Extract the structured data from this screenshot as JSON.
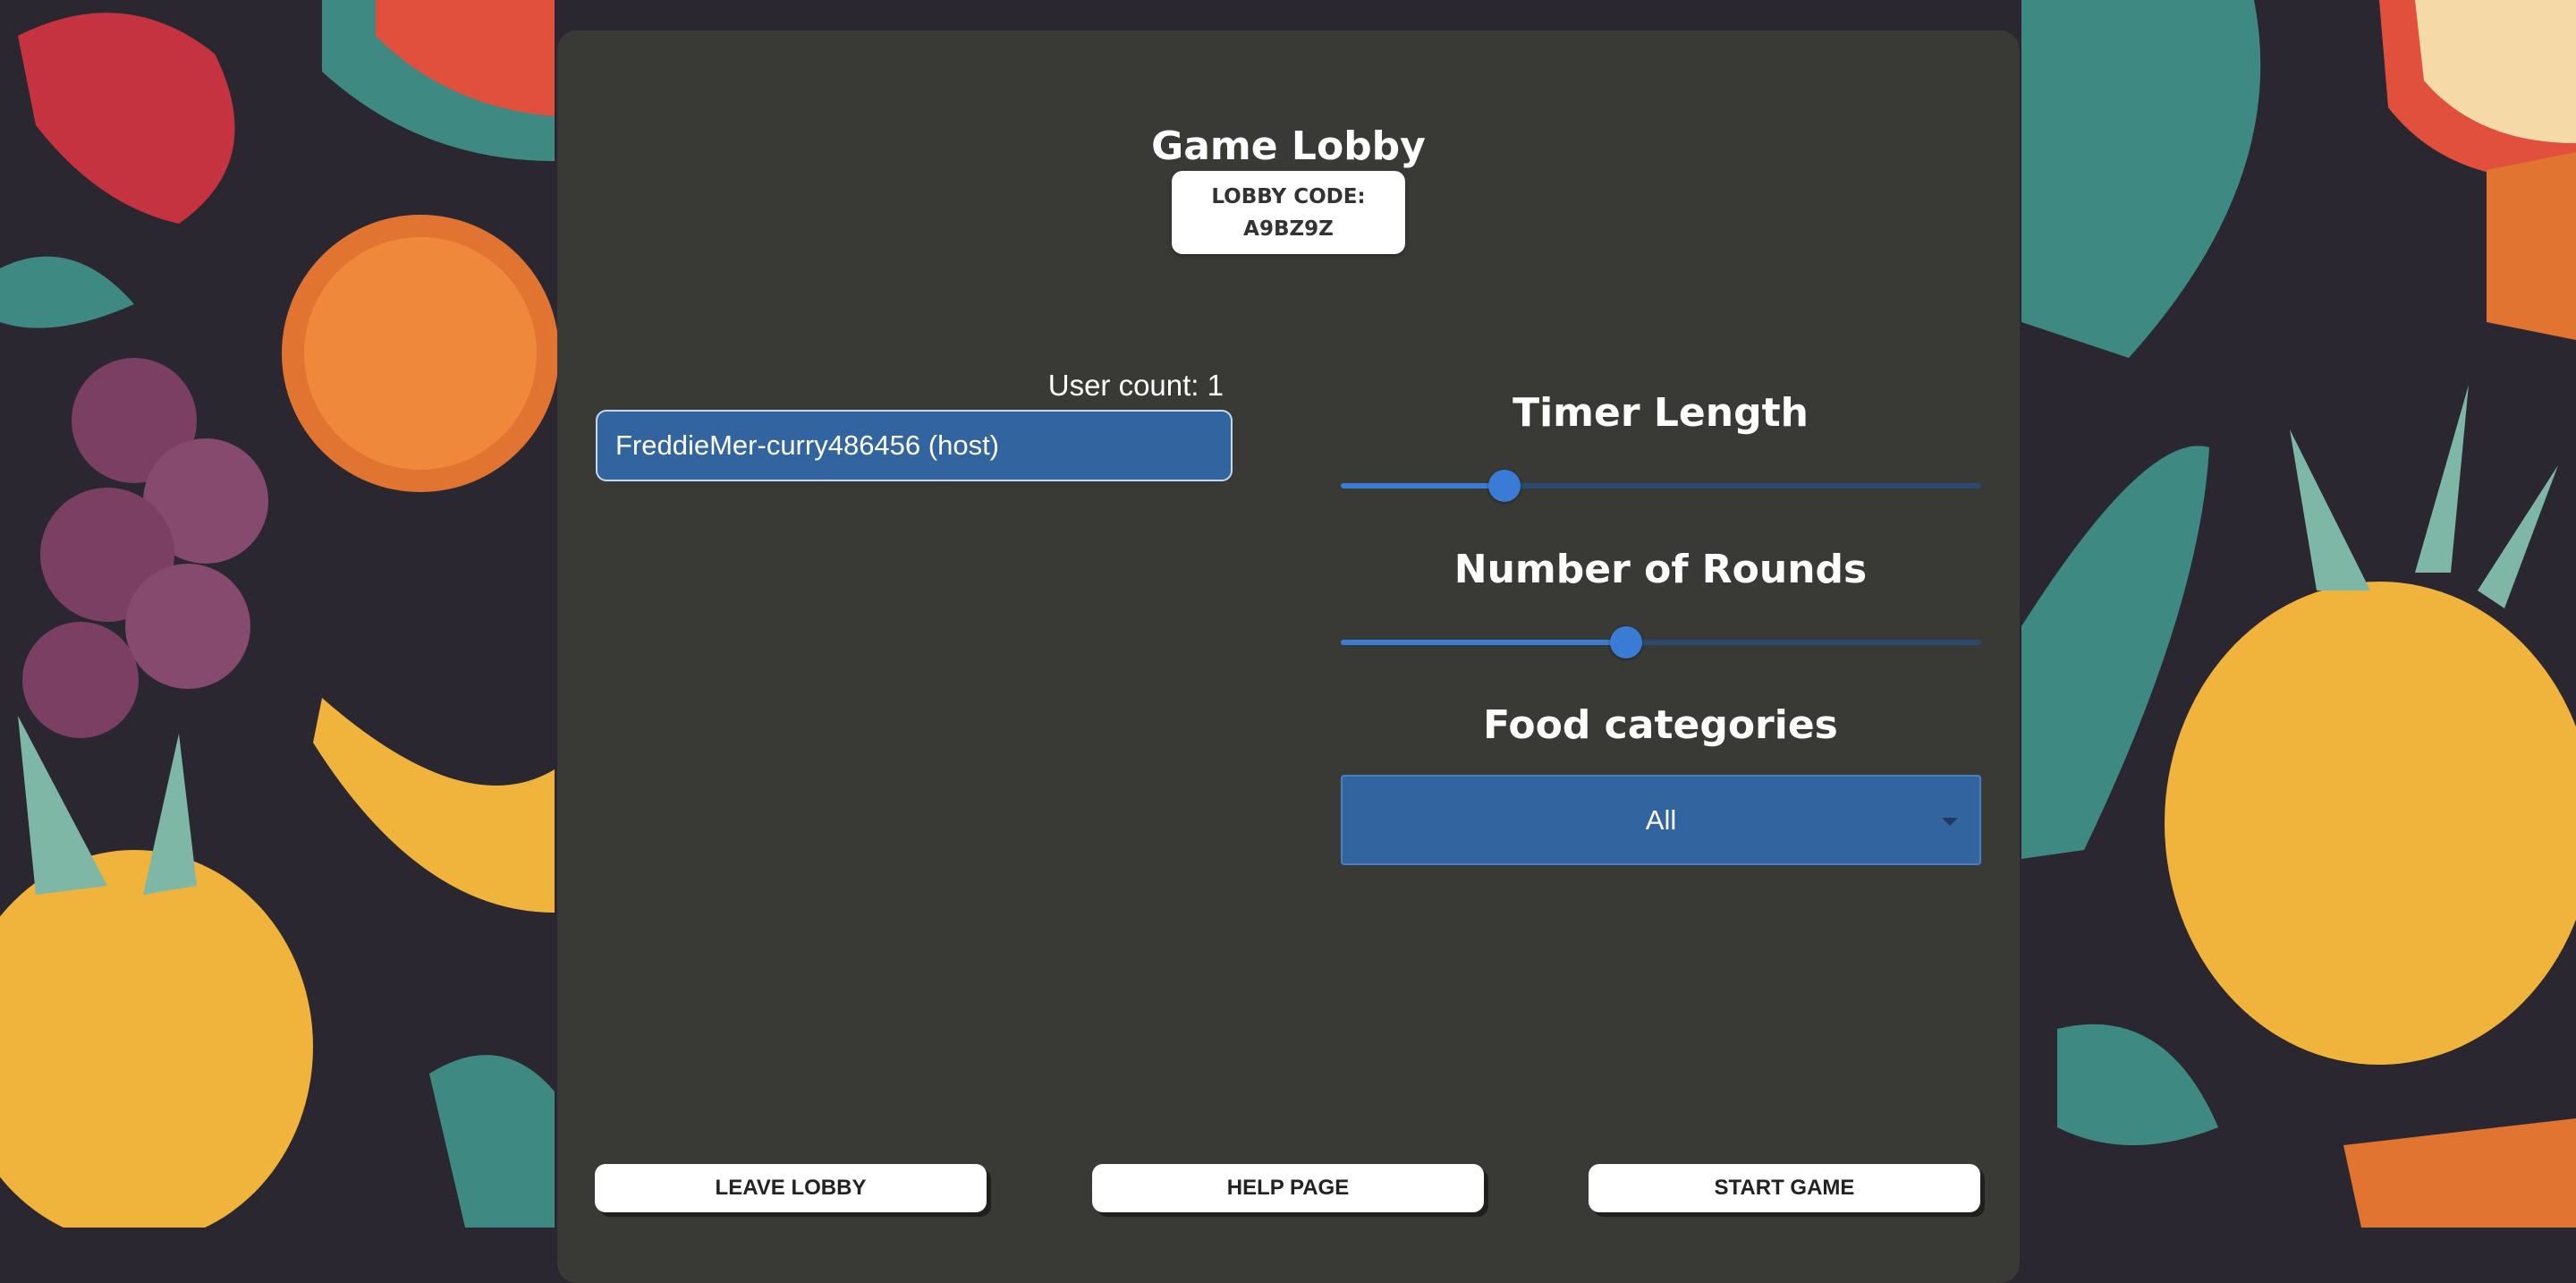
{
  "lobby": {
    "title": "Game Lobby",
    "code_label": "LOBBY CODE:",
    "code": "A9BZ9Z"
  },
  "users": {
    "count_text": "User count: 1",
    "list": [
      "FreddieMer-curry486456 (host)"
    ]
  },
  "settings": {
    "timer": {
      "label": "Timer Length",
      "value_fraction": 0.255
    },
    "rounds": {
      "label": "Number of Rounds",
      "value_fraction": 0.445
    },
    "food": {
      "label": "Food categories",
      "selected": "All"
    }
  },
  "buttons": {
    "leave": "LEAVE LOBBY",
    "help": "HELP PAGE",
    "start": "START GAME"
  },
  "colors": {
    "panel": "#393935",
    "accent": "#3a7bd5",
    "user_item": "#3264a0"
  },
  "icons": {
    "dropdown": "caret-down-icon"
  }
}
